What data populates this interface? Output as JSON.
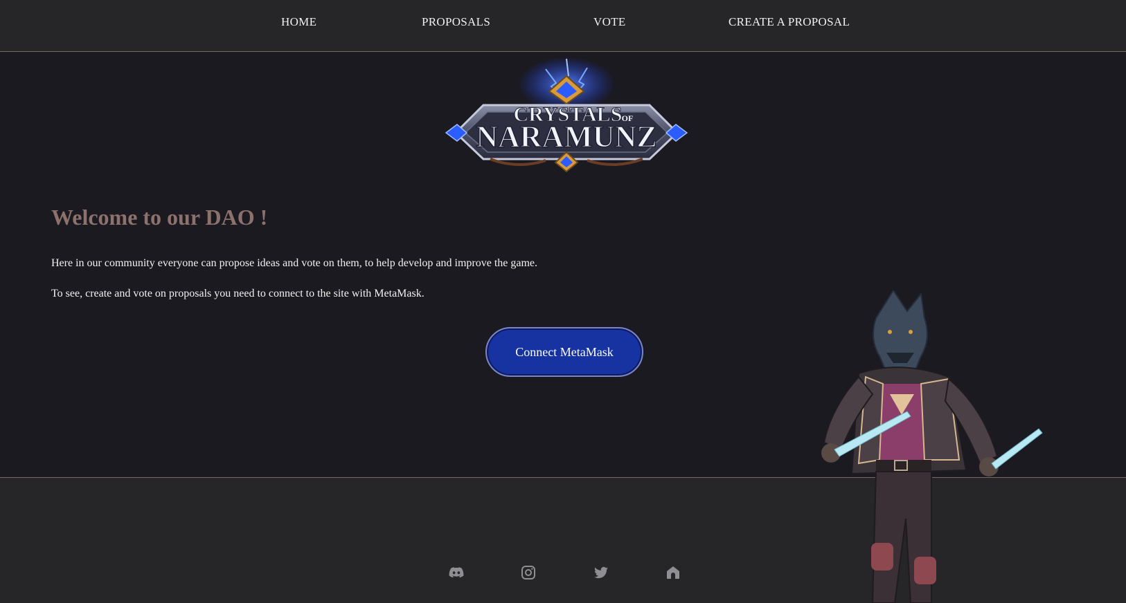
{
  "nav": {
    "items": [
      {
        "label": "HOME"
      },
      {
        "label": "PROPOSALS"
      },
      {
        "label": "VOTE"
      },
      {
        "label": "CREATE A PROPOSAL"
      }
    ]
  },
  "logo": {
    "line1": "CRYSTALS",
    "of": "OF",
    "line2": "NARAMUNZ"
  },
  "main": {
    "title": "Welcome to our DAO !",
    "paragraph_1": "Here in our community everyone can propose ideas and vote on them, to help develop and improve the game.",
    "paragraph_2": "To see, create and vote on proposals you need to connect to the site with MetaMask.",
    "connect_button": "Connect MetaMask"
  },
  "footer": {
    "social_icons": [
      "discord-icon",
      "instagram-icon",
      "twitter-icon",
      "home-icon"
    ]
  },
  "colors": {
    "background": "#1b1a21",
    "nav_footer": "#262527",
    "accent_title": "#8c716c",
    "button": "#1733a1",
    "icon_gray": "#8e8e93"
  }
}
